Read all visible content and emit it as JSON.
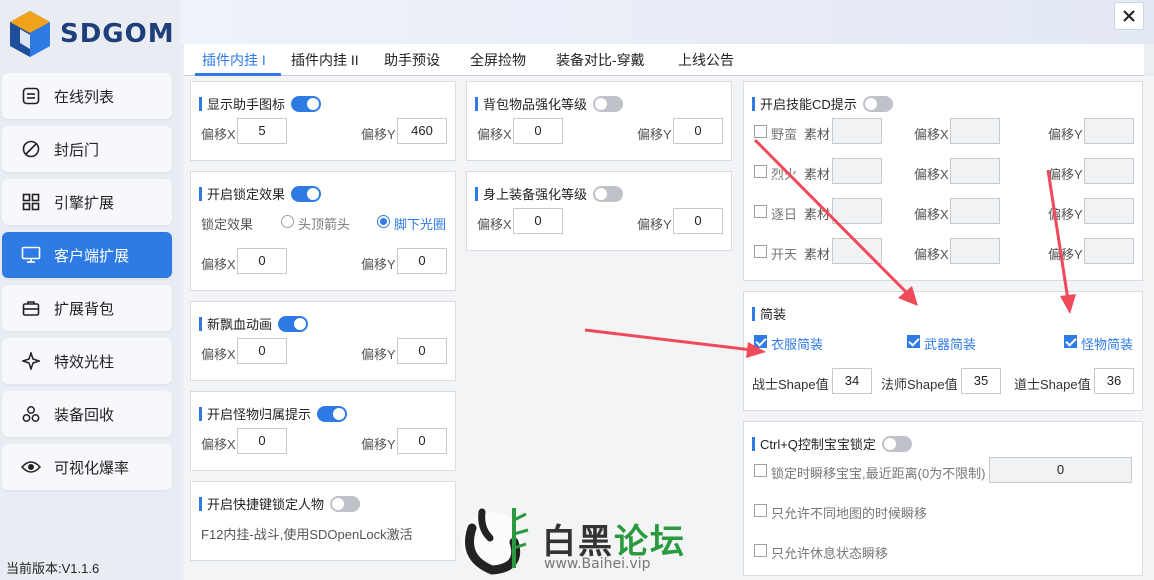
{
  "app": {
    "logo_text": "SDGOM",
    "version": "当前版本:V1.1.6"
  },
  "sidebar": {
    "items": [
      {
        "label": "在线列表",
        "icon": "list-icon"
      },
      {
        "label": "封后门",
        "icon": "ban-icon"
      },
      {
        "label": "引擎扩展",
        "icon": "grid-icon"
      },
      {
        "label": "客户端扩展",
        "icon": "monitor-icon",
        "active": true
      },
      {
        "label": "扩展背包",
        "icon": "bag-icon"
      },
      {
        "label": "特效光柱",
        "icon": "sparkle-icon"
      },
      {
        "label": "装备回收",
        "icon": "recycle-icon"
      },
      {
        "label": "可视化爆率",
        "icon": "eye-icon"
      }
    ]
  },
  "tabs": [
    "插件内挂 I",
    "插件内挂 II",
    "助手预设",
    "全屏捡物",
    "装备对比-穿戴",
    "上线公告"
  ],
  "panels": {
    "helper_icon": {
      "title": "显示助手图标",
      "toggle": true,
      "offset_x_label": "偏移X",
      "offset_x": "5",
      "offset_y_label": "偏移Y",
      "offset_y": "460"
    },
    "lock_effect": {
      "title": "开启锁定效果",
      "toggle": true,
      "effect_label": "锁定效果",
      "option1": "头顶箭头",
      "option2": "脚下光圈",
      "selected": "option2",
      "offset_x_label": "偏移X",
      "offset_x": "0",
      "offset_y_label": "偏移Y",
      "offset_y": "0"
    },
    "blood_anim": {
      "title": "新飘血动画",
      "toggle": true,
      "offset_x_label": "偏移X",
      "offset_x": "0",
      "offset_y_label": "偏移Y",
      "offset_y": "0"
    },
    "monster_owner": {
      "title": "开启怪物归属提示",
      "toggle": true,
      "offset_x_label": "偏移X",
      "offset_x": "0",
      "offset_y_label": "偏移Y",
      "offset_y": "0"
    },
    "hotkey_lock": {
      "title": "开启快捷键锁定人物",
      "toggle": false,
      "desc": "F12内挂-战斗,使用SDOpenLock激活"
    },
    "bag_strengthen": {
      "title": "背包物品强化等级",
      "toggle": false,
      "offset_x_label": "偏移X",
      "offset_x": "0",
      "offset_y_label": "偏移Y",
      "offset_y": "0"
    },
    "body_strengthen": {
      "title": "身上装备强化等级",
      "toggle": false,
      "offset_x_label": "偏移X",
      "offset_x": "0",
      "offset_y_label": "偏移Y",
      "offset_y": "0"
    },
    "skill_cd": {
      "title": "开启技能CD提示",
      "toggle": false,
      "material_label": "素材",
      "offset_x_label": "偏移X",
      "offset_y_label": "偏移Y",
      "skills": [
        "野蛮",
        "烈火",
        "逐日",
        "开天"
      ]
    },
    "simple": {
      "title": "简装",
      "clothes": "衣服简装",
      "weapon": "武器简装",
      "monster": "怪物简装",
      "warrior_label": "战士Shape值",
      "warrior": "34",
      "mage_label": "法师Shape值",
      "mage": "35",
      "taoist_label": "道士Shape值",
      "taoist": "36"
    },
    "ctrl_q": {
      "title": "Ctrl+Q控制宝宝锁定",
      "toggle": false,
      "opt1": "锁定时瞬移宝宝,最近距离(0为不限制)",
      "opt1_value": "0",
      "opt2": "只允许不同地图的时候瞬移",
      "opt3": "只允许休息状态瞬移"
    }
  },
  "watermark": {
    "name_part1": "白黑",
    "name_part2": "论坛",
    "url": "www.Baihei.vip"
  },
  "colors": {
    "accent": "#2f7be6",
    "arrow": "#f04a5a"
  }
}
